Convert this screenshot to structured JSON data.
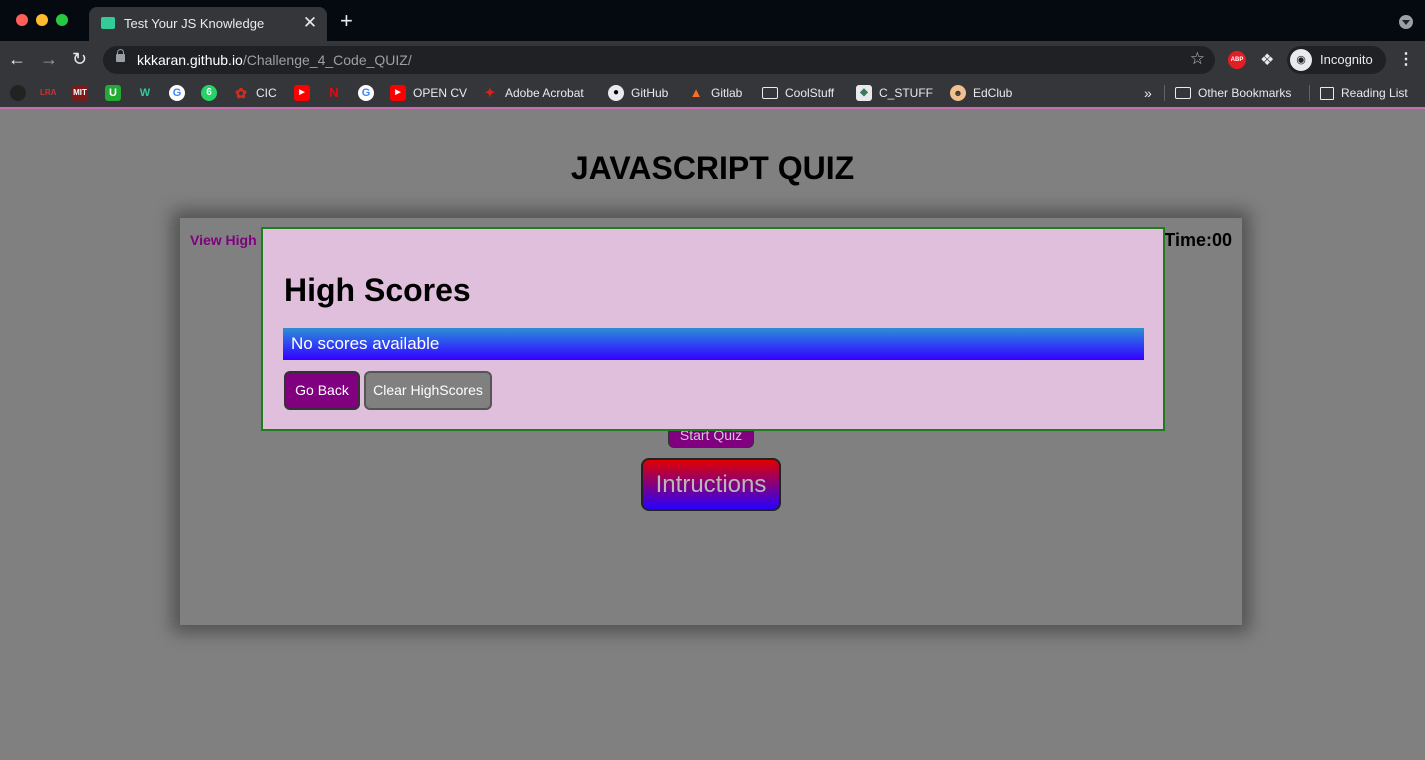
{
  "browser": {
    "tab_title": "Test Your JS Knowledge",
    "tab_close": "✕",
    "new_tab": "+",
    "url_host": "kkkaran.github.io",
    "url_path": "/Challenge_4_Code_QUIZ/",
    "profile_label": "Incognito",
    "bookmarks": [
      {
        "label": "",
        "icon": "circle-icon",
        "color": "#222222"
      },
      {
        "label": "",
        "icon": "lra-icon",
        "color": "#35363a",
        "text": "LRA"
      },
      {
        "label": "",
        "icon": "mit-ocw-icon",
        "color": "#7a1a1a",
        "text": "MIT"
      },
      {
        "label": "",
        "icon": "u-icon",
        "color": "#22aa33",
        "text": "U"
      },
      {
        "label": "",
        "icon": "w-icon",
        "color": "#35363a",
        "text": "W"
      },
      {
        "label": "",
        "icon": "google-icon",
        "color": "#ffffff",
        "text": "G"
      },
      {
        "label": "",
        "icon": "whatsapp-icon",
        "color": "#25d366",
        "text": "6"
      },
      {
        "label": "CIC",
        "icon": "maple-leaf-icon",
        "color": "#d52b1e"
      },
      {
        "label": "",
        "icon": "youtube-icon",
        "color": "#ff0000"
      },
      {
        "label": "",
        "icon": "netflix-icon",
        "color": "#e50914",
        "text": "N"
      },
      {
        "label": "",
        "icon": "google-icon",
        "color": "#ffffff",
        "text": "G"
      },
      {
        "label": "OPEN CV",
        "icon": "youtube-icon",
        "color": "#ff0000"
      },
      {
        "label": "Adobe Acrobat",
        "icon": "acrobat-icon",
        "color": "#e0201b"
      },
      {
        "label": "GitHub",
        "icon": "github-icon",
        "color": "#e8eaed"
      },
      {
        "label": "Gitlab",
        "icon": "gitlab-icon",
        "color": "#fc6d26"
      },
      {
        "label": "CoolStuff",
        "icon": "folder-icon",
        "color": "#35363a"
      },
      {
        "label": "C_STUFF",
        "icon": "c-stuff-icon",
        "color": "#3a7a5a"
      },
      {
        "label": "EdClub",
        "icon": "edclub-icon",
        "color": "#f0c090"
      }
    ],
    "overflow": "»",
    "other_bookmarks": "Other Bookmarks",
    "reading_list": "Reading List"
  },
  "page": {
    "title": "JAVASCRIPT QUIZ",
    "view_highscores": "View High",
    "timer": "Time:00",
    "start_button": "Start Quiz",
    "instructions_button": "Intructions"
  },
  "modal": {
    "title": "High Scores",
    "scores_message": "No scores available",
    "go_back": "Go Back",
    "clear": "Clear HighScores"
  },
  "colors": {
    "page_background": "#808080",
    "modal_background": "#dfbfdc",
    "modal_border": "#1e7e1e",
    "accent_purple": "#800080",
    "bookmark_bar_border": "#c76cae"
  }
}
